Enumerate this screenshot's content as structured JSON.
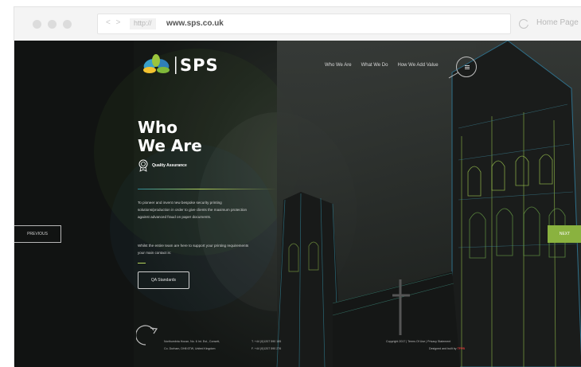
{
  "browser": {
    "nav_arrows": "< >",
    "protocol": "http://",
    "url": "www.sps.co.uk",
    "home_label": "Home Page"
  },
  "site": {
    "logo_text": "SPS",
    "nav": [
      "Who We Are",
      "What We Do",
      "How We Add Value"
    ],
    "hero": {
      "title_line1": "Who",
      "title_line2": "We Are",
      "badge_label": "Quality Assurance",
      "paragraph1": "To pioneer and invent new bespoke security printing solutions/production in order to give clients the maximum protection against advanced fraud on paper documents.",
      "paragraph2": "Whilst the entire team are here to support your printing requirements your main contact is:",
      "cta_label": "QA Standards"
    },
    "prev_label": "PREVIOUS",
    "next_label": "NEXT",
    "footer": {
      "address_line1": "Northumbria House, No. 6 Int. Est., Consett,",
      "address_line2": "Co. Durham, DH8 6TW, United Kingdom",
      "tel_line1": "T. +44 (0)1207 590 185",
      "tel_line2": "F. +44 (0)1207 590 276",
      "copyright": "Copyright 2017 | Terms Of Use | Privacy Statement",
      "built_by": "Designed and built by",
      "built_by_brand": "TFPB"
    },
    "colors": {
      "accent_green": "#8ab23f",
      "accent_teal": "#2d8a9a",
      "background": "#111312"
    }
  }
}
